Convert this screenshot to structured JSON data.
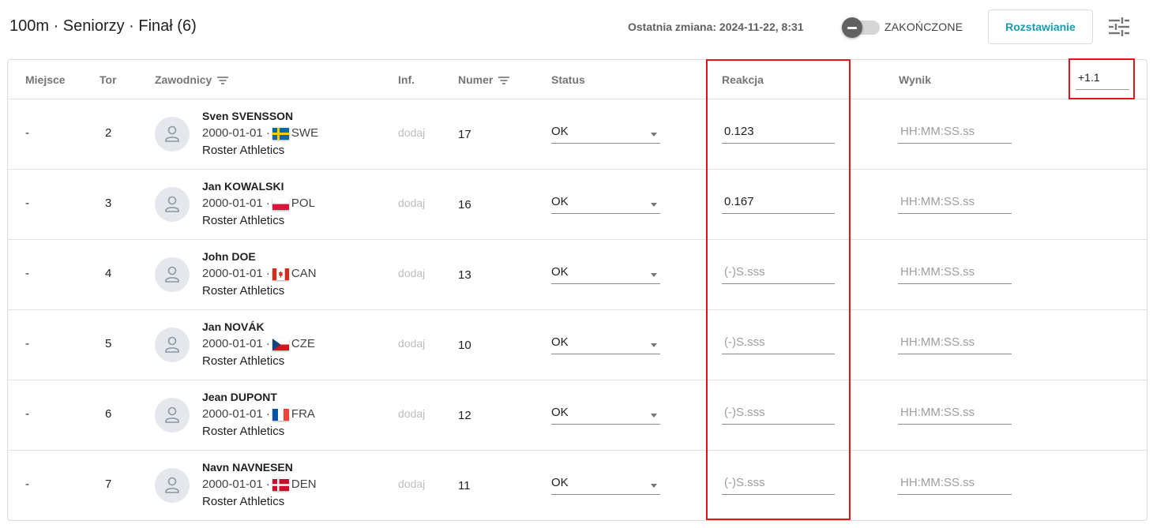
{
  "header": {
    "title": "100m · Seniorzy · Finał (6)",
    "last_change": "Ostatnia zmiana: 2024-11-22, 8:31",
    "toggle_label": "ZAKOŃCZONE",
    "roster_button": "Rozstawianie",
    "settings_icon": "tune-icon"
  },
  "table": {
    "columns": {
      "place": "Miejsce",
      "lane": "Tor",
      "athletes": "Zawodnicy",
      "info": "Inf.",
      "number": "Numer",
      "status": "Status",
      "reaction": "Reakcja",
      "result": "Wynik"
    },
    "wind": "+1.1",
    "rows": [
      {
        "place": "-",
        "lane": "2",
        "name": "Sven SVENSSON",
        "dob": "2000-01-01 ·",
        "country": "SWE",
        "club": "Roster Athletics",
        "inf": "dodaj",
        "number": "17",
        "status": "OK",
        "reaction": "0.123",
        "result": "HH:MM:SS.ss"
      },
      {
        "place": "-",
        "lane": "3",
        "name": "Jan KOWALSKI",
        "dob": "2000-01-01 ·",
        "country": "POL",
        "club": "Roster Athletics",
        "inf": "dodaj",
        "number": "16",
        "status": "OK",
        "reaction": "0.167",
        "result": "HH:MM:SS.ss"
      },
      {
        "place": "-",
        "lane": "4",
        "name": "John DOE",
        "dob": "2000-01-01 ·",
        "country": "CAN",
        "club": "Roster Athletics",
        "inf": "dodaj",
        "number": "13",
        "status": "OK",
        "reaction": "(-)S.sss",
        "result": "HH:MM:SS.ss"
      },
      {
        "place": "-",
        "lane": "5",
        "name": "Jan NOVÁK",
        "dob": "2000-01-01 ·",
        "country": "CZE",
        "club": "Roster Athletics",
        "inf": "dodaj",
        "number": "10",
        "status": "OK",
        "reaction": "(-)S.sss",
        "result": "HH:MM:SS.ss"
      },
      {
        "place": "-",
        "lane": "6",
        "name": "Jean DUPONT",
        "dob": "2000-01-01 ·",
        "country": "FRA",
        "club": "Roster Athletics",
        "inf": "dodaj",
        "number": "12",
        "status": "OK",
        "reaction": "(-)S.sss",
        "result": "HH:MM:SS.ss"
      },
      {
        "place": "-",
        "lane": "7",
        "name": "Navn NAVNESEN",
        "dob": "2000-01-01 ·",
        "country": "DEN",
        "club": "Roster Athletics",
        "inf": "dodaj",
        "number": "11",
        "status": "OK",
        "reaction": "(-)S.sss",
        "result": "HH:MM:SS.ss"
      }
    ]
  },
  "colors": {
    "accent": "#1a9bb3",
    "highlight": "#e3121b"
  }
}
